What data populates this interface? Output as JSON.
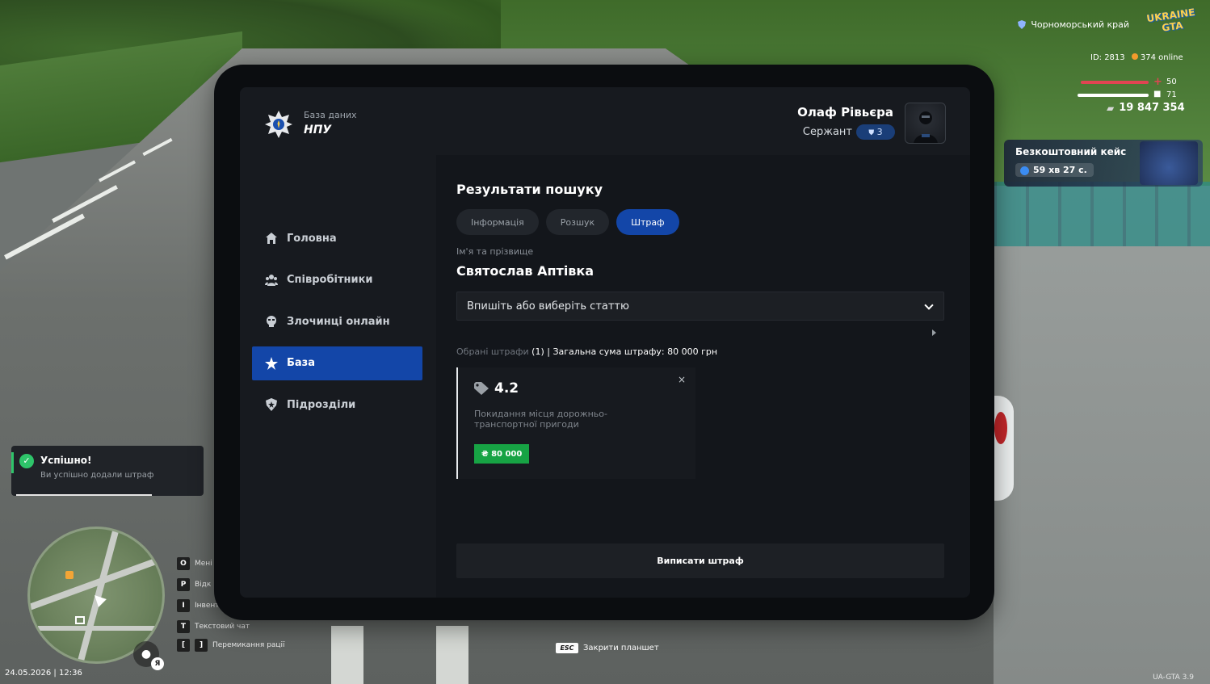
{
  "hud": {
    "region": "Чорноморський край",
    "logo": "UKRAINE GTA",
    "player_id": "ID: 2813",
    "online": "374 online",
    "health": 50,
    "armor": 71,
    "money": "19 847 354",
    "free_case": {
      "title": "Безкоштовний кейс",
      "timer": "59 хв 27 с."
    }
  },
  "toast": {
    "title": "Успішно!",
    "message": "Ви успішно додали штраф"
  },
  "hotkeys": [
    {
      "keys": [
        "O"
      ],
      "label": "Мені"
    },
    {
      "keys": [
        "P"
      ],
      "label": "Відк"
    },
    {
      "keys": [
        "I"
      ],
      "label": "Інвент"
    },
    {
      "keys": [
        "T"
      ],
      "label": "Текстовий чат"
    },
    {
      "keys": [
        "[",
        "]"
      ],
      "label": "Перемикання рації"
    }
  ],
  "voice_badge": "Я",
  "datetime": "24.05.2026 | 12:36",
  "version": "UA-GTA 3.9",
  "esc_hint": {
    "key": "ESC",
    "label": "Закрити планшет"
  },
  "tablet": {
    "logo": {
      "subtitle": "База даних",
      "title": "НПУ"
    },
    "nav": [
      {
        "label": "Головна",
        "icon": "home-icon"
      },
      {
        "label": "Співробітники",
        "icon": "users-icon"
      },
      {
        "label": "Злочинці онлайн",
        "icon": "criminal-icon"
      },
      {
        "label": "База",
        "icon": "star-icon",
        "active": true
      },
      {
        "label": "Підрозділи",
        "icon": "shield-icon"
      }
    ],
    "user": {
      "name": "Олаф Рівьєра",
      "rank": "Сержант",
      "rank_level": "3"
    },
    "section_title": "Результати пошуку",
    "tabs": [
      {
        "label": "Інформація"
      },
      {
        "label": "Розшук"
      },
      {
        "label": "Штраф",
        "active": true
      }
    ],
    "person": {
      "label": "Ім'я та прізвище",
      "name": "Святослав Аптівка"
    },
    "article_select": {
      "placeholder": "Впишіть або виберіть статтю"
    },
    "summary": {
      "selected_label": "Обрані штрафи",
      "count": "(1)",
      "total": "| Загальна сума штрафу: 80 000 грн"
    },
    "fine": {
      "code": "4.2",
      "description": "Покидання місця дорожньо-транспортної пригоди",
      "amount": "₴ 80 000",
      "close": "×"
    },
    "submit_label": "Виписати штраф"
  }
}
